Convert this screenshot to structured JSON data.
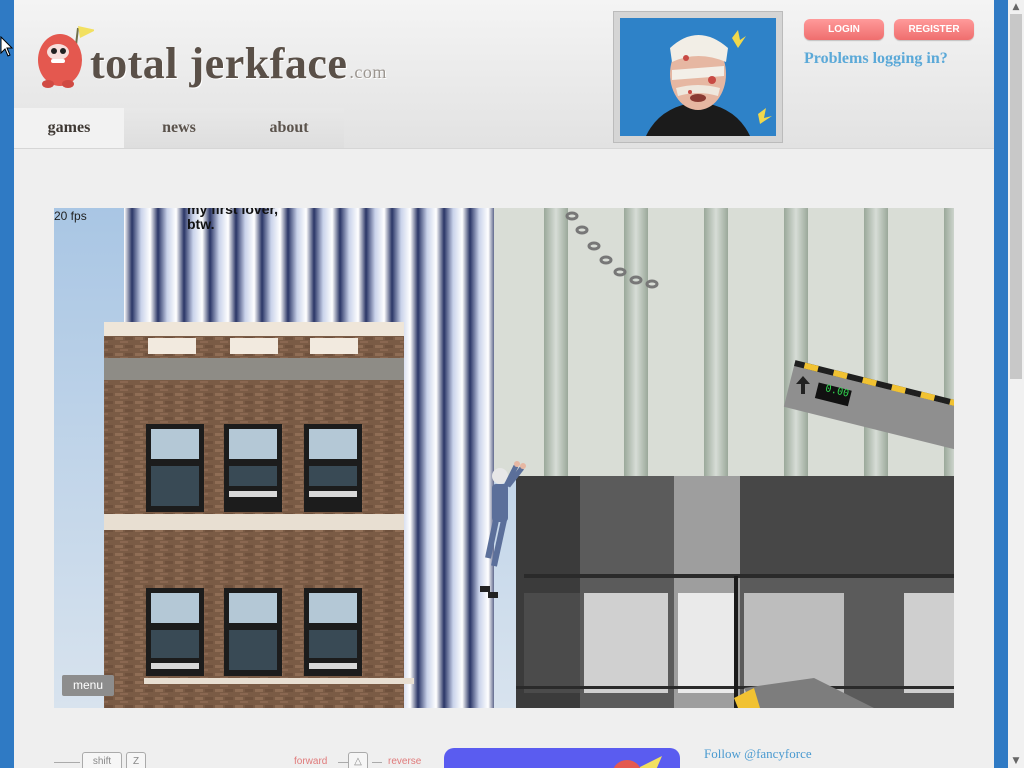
{
  "brand": {
    "name": "total jerkface",
    "tld": ".com"
  },
  "nav": {
    "items": [
      {
        "label": "games",
        "active": true
      },
      {
        "label": "news",
        "active": false
      },
      {
        "label": "about",
        "active": false
      }
    ]
  },
  "auth": {
    "login_label": "LOGIN",
    "register_label": "REGISTER",
    "problems_label": "Problems logging in?"
  },
  "game": {
    "fps_label": "20 fps",
    "dialog_line1": "my first lover,",
    "dialog_line2": "btw.",
    "menu_label": "menu",
    "timer_display": "0.00"
  },
  "controls": {
    "key_shift": "shift",
    "key_z": "Z",
    "forward_label": "forward",
    "reverse_label": "reverse",
    "arrow_key": "△"
  },
  "social": {
    "follow_label": "Follow @fancyforce"
  },
  "colors": {
    "page_bg": "#2f7ac4",
    "accent_button": "#ef6e6e",
    "link": "#5ba9d8"
  }
}
